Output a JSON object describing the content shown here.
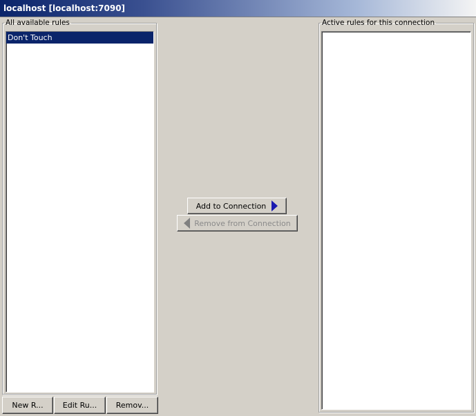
{
  "window": {
    "title": "localhost [localhost:7090]"
  },
  "available_rules": {
    "legend": "All available rules",
    "items": [
      {
        "label": "Don't Touch",
        "selected": true
      }
    ],
    "buttons": {
      "new": "New R...",
      "edit": "Edit Ru...",
      "remove": "Remov..."
    }
  },
  "actions": {
    "add": {
      "label": "Add to Connection",
      "enabled": true
    },
    "remove": {
      "label": "Remove from Connection",
      "enabled": false
    }
  },
  "active_rules": {
    "legend": "Active rules for this connection",
    "items": []
  },
  "colors": {
    "selection": "#0a246a",
    "add_arrow": "#1a1ab0",
    "disabled_text": "#8a8a8a",
    "window_bg": "#d4d0c8"
  }
}
